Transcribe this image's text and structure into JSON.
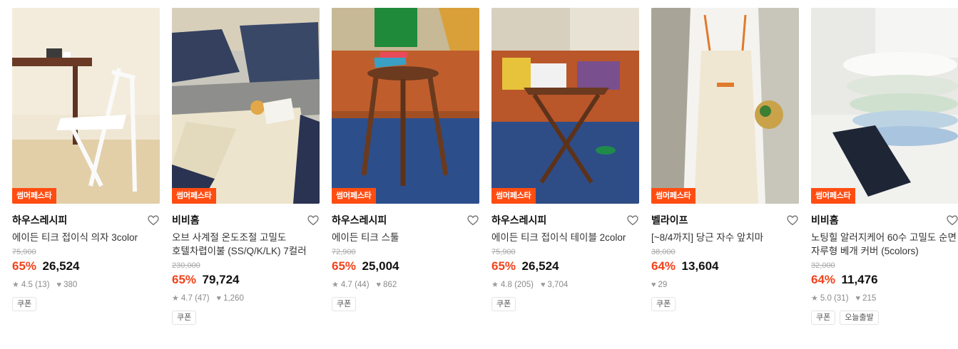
{
  "products": [
    {
      "badge": "썸머페스타",
      "brand": "하우스레시피",
      "title": "에이든 티크 접이식 의자 3color",
      "original_price": "75,900",
      "discount": "65%",
      "price": "26,524",
      "rating": "4.5",
      "reviews": "(13)",
      "likes": "380",
      "tags": [
        "쿠폰"
      ],
      "image": "white-folding-chair"
    },
    {
      "badge": "썸머페스타",
      "brand": "비비홈",
      "title": "오브 사계절 온도조절 고밀도 호텔차렵이불 (SS/Q/K/LK) 7컬러",
      "original_price": "230,000",
      "discount": "65%",
      "price": "79,724",
      "rating": "4.7",
      "reviews": "(47)",
      "likes": "1,260",
      "tags": [
        "쿠폰"
      ],
      "image": "navy-cream-bedding"
    },
    {
      "badge": "썸머페스타",
      "brand": "하우스레시피",
      "title": "에이든 티크 스툴",
      "original_price": "72,900",
      "discount": "65%",
      "price": "25,004",
      "rating": "4.7",
      "reviews": "(44)",
      "likes": "862",
      "tags": [
        "쿠폰"
      ],
      "image": "teak-stool"
    },
    {
      "badge": "썸머페스타",
      "brand": "하우스레시피",
      "title": "에이든 티크 접이식 테이블 2color",
      "original_price": "75,900",
      "discount": "65%",
      "price": "26,524",
      "rating": "4.8",
      "reviews": "(205)",
      "likes": "3,704",
      "tags": [
        "쿠폰"
      ],
      "image": "folding-table"
    },
    {
      "badge": "썸머페스타",
      "brand": "벨라이프",
      "title": "[~8/4까지] 당근 자수 앞치마",
      "original_price": "38,000",
      "discount": "64%",
      "price": "13,604",
      "rating": "",
      "reviews": "",
      "likes": "29",
      "tags": [
        "쿠폰"
      ],
      "image": "carrot-apron"
    },
    {
      "badge": "썸머페스타",
      "brand": "비비홈",
      "title": "노팅힐 알러지케어 60수 고밀도 순면 자루형 베개 커버 (5colors)",
      "original_price": "32,000",
      "discount": "64%",
      "price": "11,476",
      "rating": "5.0",
      "reviews": "(31)",
      "likes": "215",
      "tags": [
        "쿠폰",
        "오늘출발"
      ],
      "image": "pillow-covers"
    }
  ],
  "colors": {
    "badge": "#ff4d12",
    "discount": "#f2421b"
  }
}
